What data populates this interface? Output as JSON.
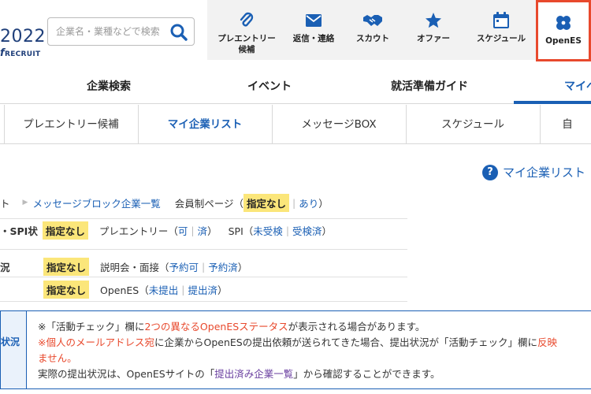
{
  "logo": {
    "year": "2022",
    "brand": "RECRUIT"
  },
  "search": {
    "placeholder": "企業名・業種などで検索"
  },
  "topnav": [
    {
      "label": "プレエントリー\n候補",
      "icon": "paperclip-icon"
    },
    {
      "label": "返信・連絡",
      "icon": "envelope-icon"
    },
    {
      "label": "スカウト",
      "icon": "handshake-icon"
    },
    {
      "label": "オファー",
      "icon": "star-icon"
    },
    {
      "label": "スケジュール",
      "icon": "calendar-icon"
    },
    {
      "label": "OpenES",
      "icon": "clover-icon"
    }
  ],
  "mainnav": [
    "企業検索",
    "イベント",
    "就活準備ガイド",
    "マイペ"
  ],
  "subnav": [
    "プレエントリー候補",
    "マイ企業リスト",
    "メッセージBOX",
    "スケジュール",
    "自"
  ],
  "help": {
    "label": "マイ企業リスト"
  },
  "filters": {
    "row1": {
      "lead": "ト",
      "link": "メッセージブロック企業一覧",
      "member_label": "会員制ページ（",
      "tag": "指定なし",
      "opt1": "あり",
      "close": "）"
    },
    "row2": {
      "lead": "・SPI状",
      "tag": "指定なし",
      "pre_label": "プレエントリー（",
      "pre_opt1": "可",
      "pre_opt2": "済",
      "close": "）",
      "spi_label": "SPI（",
      "spi_opt1": "未受検",
      "spi_opt2": "受検済"
    },
    "row3": {
      "lead": "況",
      "tag": "指定なし",
      "label": "説明会・面接（",
      "opt1": "予約可",
      "opt2": "予約済",
      "close": "）"
    },
    "row4": {
      "tag": "指定なし",
      "label": "OpenES（",
      "opt1": "未提出",
      "opt2": "提出済",
      "close": "）"
    }
  },
  "notice": {
    "label": "状況",
    "line1_a": "※「活動チェック」欄に",
    "line1_b": "2つの異なるOpenESステータス",
    "line1_c": "が表示される場合があります。",
    "line2_a": "※",
    "line2_b": "個人のメールアドレス宛",
    "line2_c": "に企業からOpenESの提出依頼が送られてきた場合、提出状況が「活動チェック」欄に",
    "line2_d": "反映",
    "line3": "ません。",
    "line4_a": "実際の提出状況は、OpenESサイトの「",
    "line4_b": "提出済み企業一覧",
    "line4_c": "」から確認することができます。"
  },
  "colors": {
    "accent": "#1a5fb4",
    "highlight": "#fbe67a",
    "alert": "#e8492d",
    "openes_border": "#e8492d"
  }
}
